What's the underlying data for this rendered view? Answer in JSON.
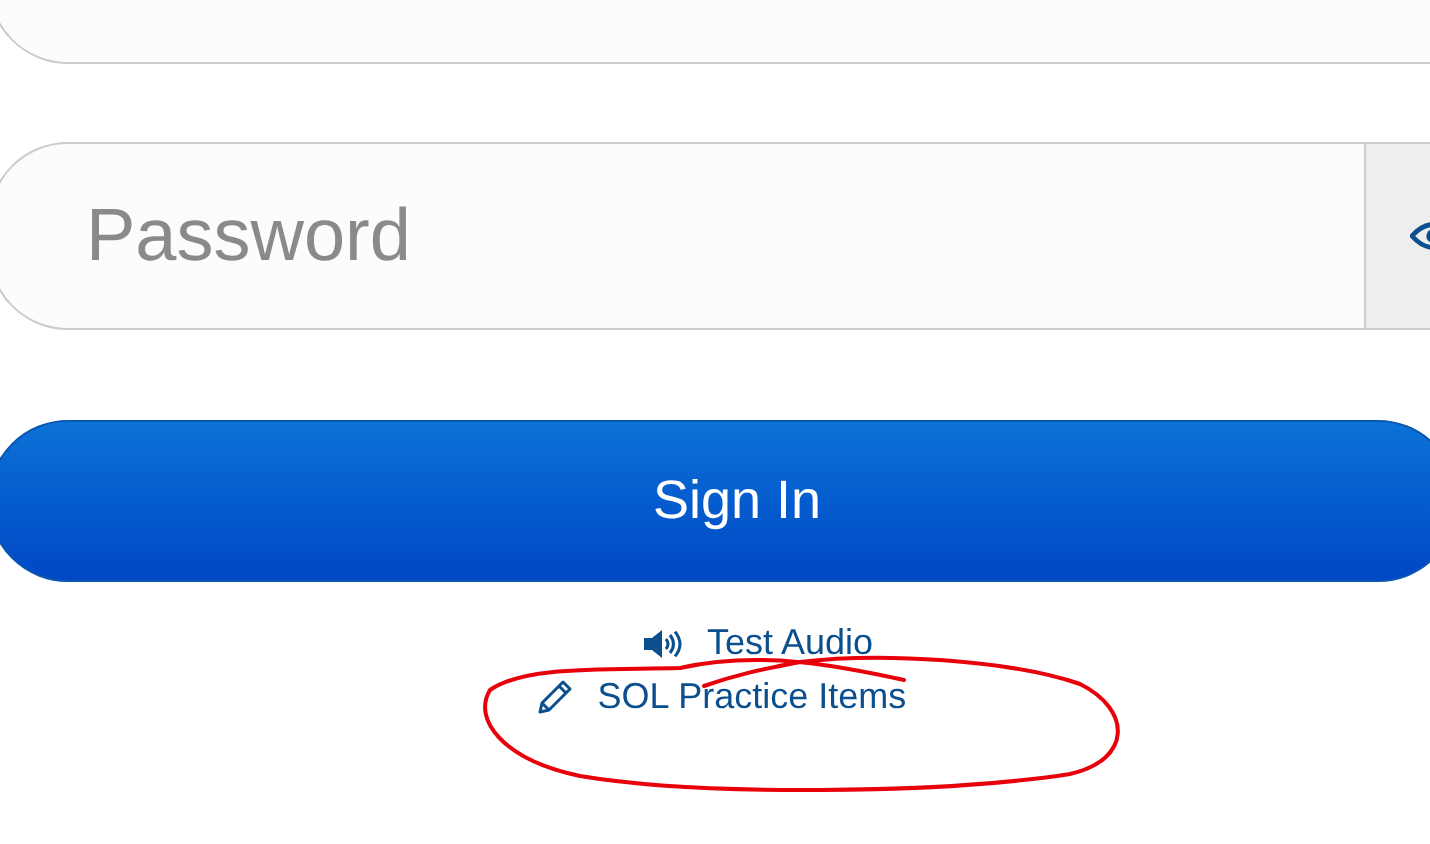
{
  "password_field": {
    "placeholder": "Password"
  },
  "sign_in_button": {
    "label": "Sign In"
  },
  "links": [
    {
      "kind": "audio",
      "label": "Test Audio"
    },
    {
      "kind": "practice",
      "label": "SOL Practice Items"
    }
  ]
}
